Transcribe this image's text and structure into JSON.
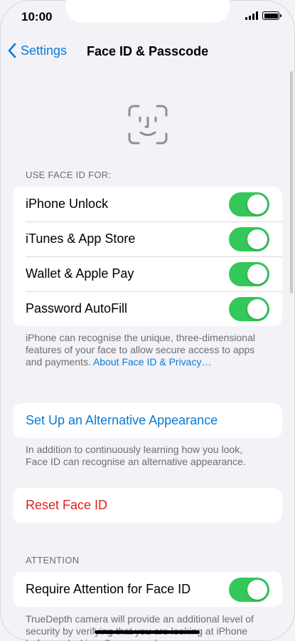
{
  "status": {
    "time": "10:00"
  },
  "nav": {
    "back_label": "Settings",
    "title": "Face ID & Passcode"
  },
  "use_face_id": {
    "header": "USE FACE ID FOR:",
    "items": [
      {
        "label": "iPhone Unlock",
        "on": true
      },
      {
        "label": "iTunes & App Store",
        "on": true
      },
      {
        "label": "Wallet & Apple Pay",
        "on": true
      },
      {
        "label": "Password AutoFill",
        "on": true
      }
    ],
    "footnote": "iPhone can recognise the unique, three-dimensional features of your face to allow secure access to apps and payments.",
    "footnote_link": "About Face ID & Privacy…"
  },
  "alternative": {
    "label": "Set Up an Alternative Appearance",
    "footnote": "In addition to continuously learning how you look, Face ID can recognise an alternative appearance."
  },
  "reset": {
    "label": "Reset Face ID"
  },
  "attention": {
    "header": "ATTENTION",
    "item": {
      "label": "Require Attention for Face ID",
      "on": true
    },
    "footnote": "TrueDepth camera will provide an additional level of security by verifying that you are looking at iPhone before unlocking. Some sunglasses"
  },
  "colors": {
    "accent": "#0a7bd6",
    "toggle_on": "#34c759",
    "danger": "#e0201b",
    "background": "#f2f2f7"
  }
}
